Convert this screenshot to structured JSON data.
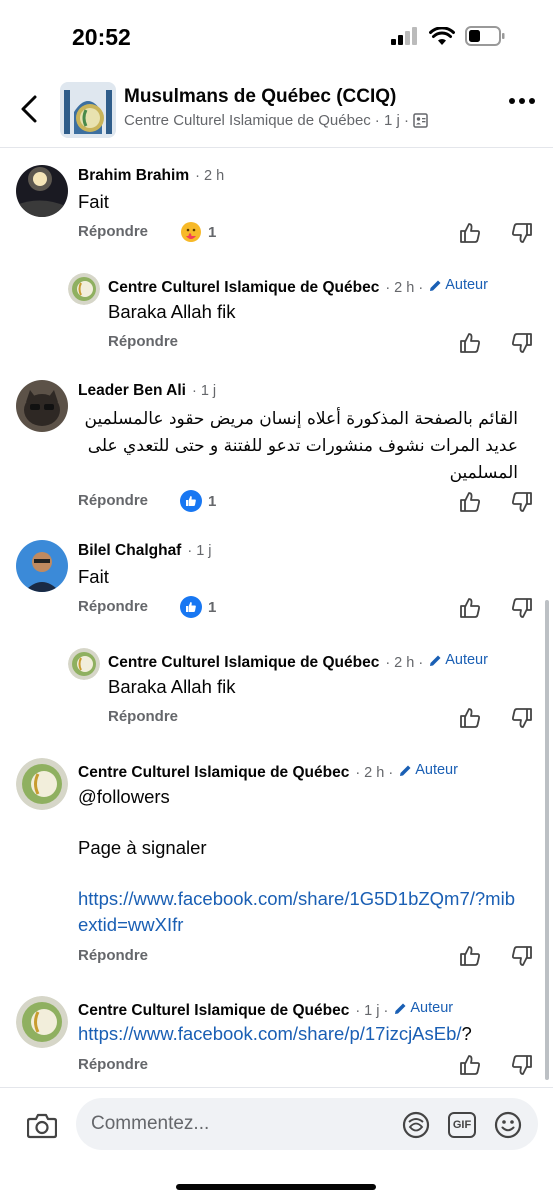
{
  "status_bar": {
    "time": "20:52"
  },
  "header": {
    "title": "Musulmans de Québec (CCIQ)",
    "subtitle_author": "Centre Culturel Islamique de Québec",
    "subtitle_time": "· 1 j ·"
  },
  "labels": {
    "reply": "Répondre",
    "author": "Auteur"
  },
  "comments": [
    {
      "name": "Brahim Brahim",
      "time": "· 2 h",
      "text": "Fait",
      "reaction_count": "1"
    },
    {
      "name": "Centre Culturel Islamique de Québec",
      "time": "· 2 h ·",
      "text": "Baraka Allah fik"
    },
    {
      "name": "Leader Ben Ali",
      "time": "· 1 j",
      "text": "القائم بالصفحة المذكورة أعلاه إنسان مريض حقود عالمسلمين عديد المرات نشوف منشورات تدعو للفتنة و حتى للتعدي على المسلمين",
      "reaction_count": "1"
    },
    {
      "name": "Bilel Chalghaf",
      "time": "· 1 j",
      "text": "Fait",
      "reaction_count": "1"
    },
    {
      "name": "Centre Culturel Islamique de Québec",
      "time": "· 2 h ·",
      "text": "Baraka Allah fik"
    },
    {
      "name": "Centre Culturel Islamique de Québec",
      "time": "· 2 h ·",
      "text_line1": "@followers",
      "text_line2": "Page à signaler",
      "link": "https://www.facebook.com/share/1G5D1bZQm7/?mibextid=wwXIfr"
    },
    {
      "name": "Centre Culturel Islamique de Québec",
      "time": "· 1 j ·",
      "link": "https://www.facebook.com/share/p/17izcjAsEb/",
      "link_suffix": "?"
    }
  ],
  "composer": {
    "placeholder": "Commentez..."
  },
  "colors": {
    "link": "#1a5fb4",
    "like_blue": "#1877f2",
    "meta_gray": "#65676b"
  }
}
